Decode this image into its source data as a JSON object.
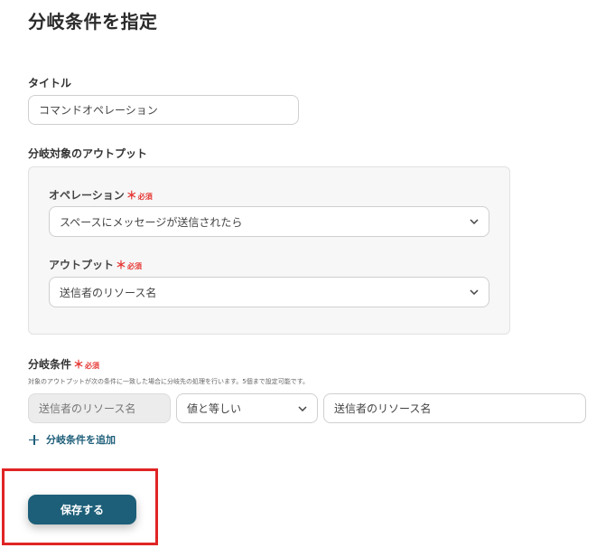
{
  "page": {
    "title": "分岐条件を指定"
  },
  "title_field": {
    "label": "タイトル",
    "value": "コマンドオペレーション"
  },
  "target_output": {
    "label": "分岐対象のアウトプット",
    "operation": {
      "label": "オペレーション",
      "required_mark": "＊",
      "required_text": "必須",
      "selected": "スペースにメッセージが送信されたら"
    },
    "output": {
      "label": "アウトプット",
      "required_mark": "＊",
      "required_text": "必須",
      "selected": "送信者のリソース名"
    }
  },
  "condition": {
    "label": "分岐条件",
    "required_mark": "＊",
    "required_text": "必須",
    "hint": "対象のアウトプットが次の条件に一致した場合に分岐先の処理を行います。5個まで設定可能です。",
    "field": "送信者のリソース名",
    "operator": "値と等しい",
    "value": "送信者のリソース名",
    "add_label": "分岐条件を追加"
  },
  "actions": {
    "save_label": "保存する"
  },
  "colors": {
    "primary": "#1d5f79",
    "required": "#e53935",
    "highlight": "#e02424"
  },
  "icons": {
    "dropdown": "chevron-down-icon",
    "add": "plus-icon"
  }
}
